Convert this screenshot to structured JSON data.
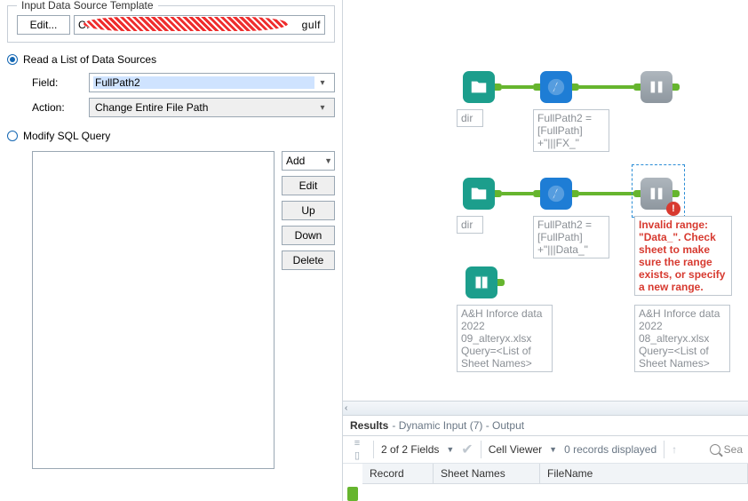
{
  "group": {
    "title": "Input Data Source Template",
    "edit_label": "Edit...",
    "path_prefix": "C:",
    "path_suffix": "gulf"
  },
  "mode": {
    "read_label": "Read a List of Data Sources",
    "modify_label": "Modify SQL Query",
    "field_label": "Field:",
    "field_value": "FullPath2",
    "action_label": "Action:",
    "action_value": "Change Entire File Path"
  },
  "stack": {
    "add": "Add",
    "edit": "Edit",
    "up": "Up",
    "down": "Down",
    "delete": "Delete"
  },
  "canvas": {
    "flow1": {
      "dir_anno": "dir",
      "formula_anno": "FullPath2 = [FullPath] +\"|||FX_\""
    },
    "flow2": {
      "dir_anno": "dir",
      "formula_anno": "FullPath2 = [FullPath] +\"|||Data_\"",
      "error": "Invalid range: \"Data_\". Check sheet to make sure the range exists, or specify a new range."
    },
    "dyn1": "A&H Inforce data 2022 09_alteryx.xlsx Query=<List of Sheet Names>",
    "dyn2": "A&H Inforce data 2022 08_alteryx.xlsx Query=<List of Sheet Names>"
  },
  "results": {
    "title": "Results",
    "sub": "- Dynamic Input (7) - Output",
    "fields": "2 of 2 Fields",
    "cellviewer": "Cell Viewer",
    "records": "0 records displayed",
    "search": "Sea",
    "col1": "Record",
    "col2": "Sheet Names",
    "col3": "FileName"
  }
}
